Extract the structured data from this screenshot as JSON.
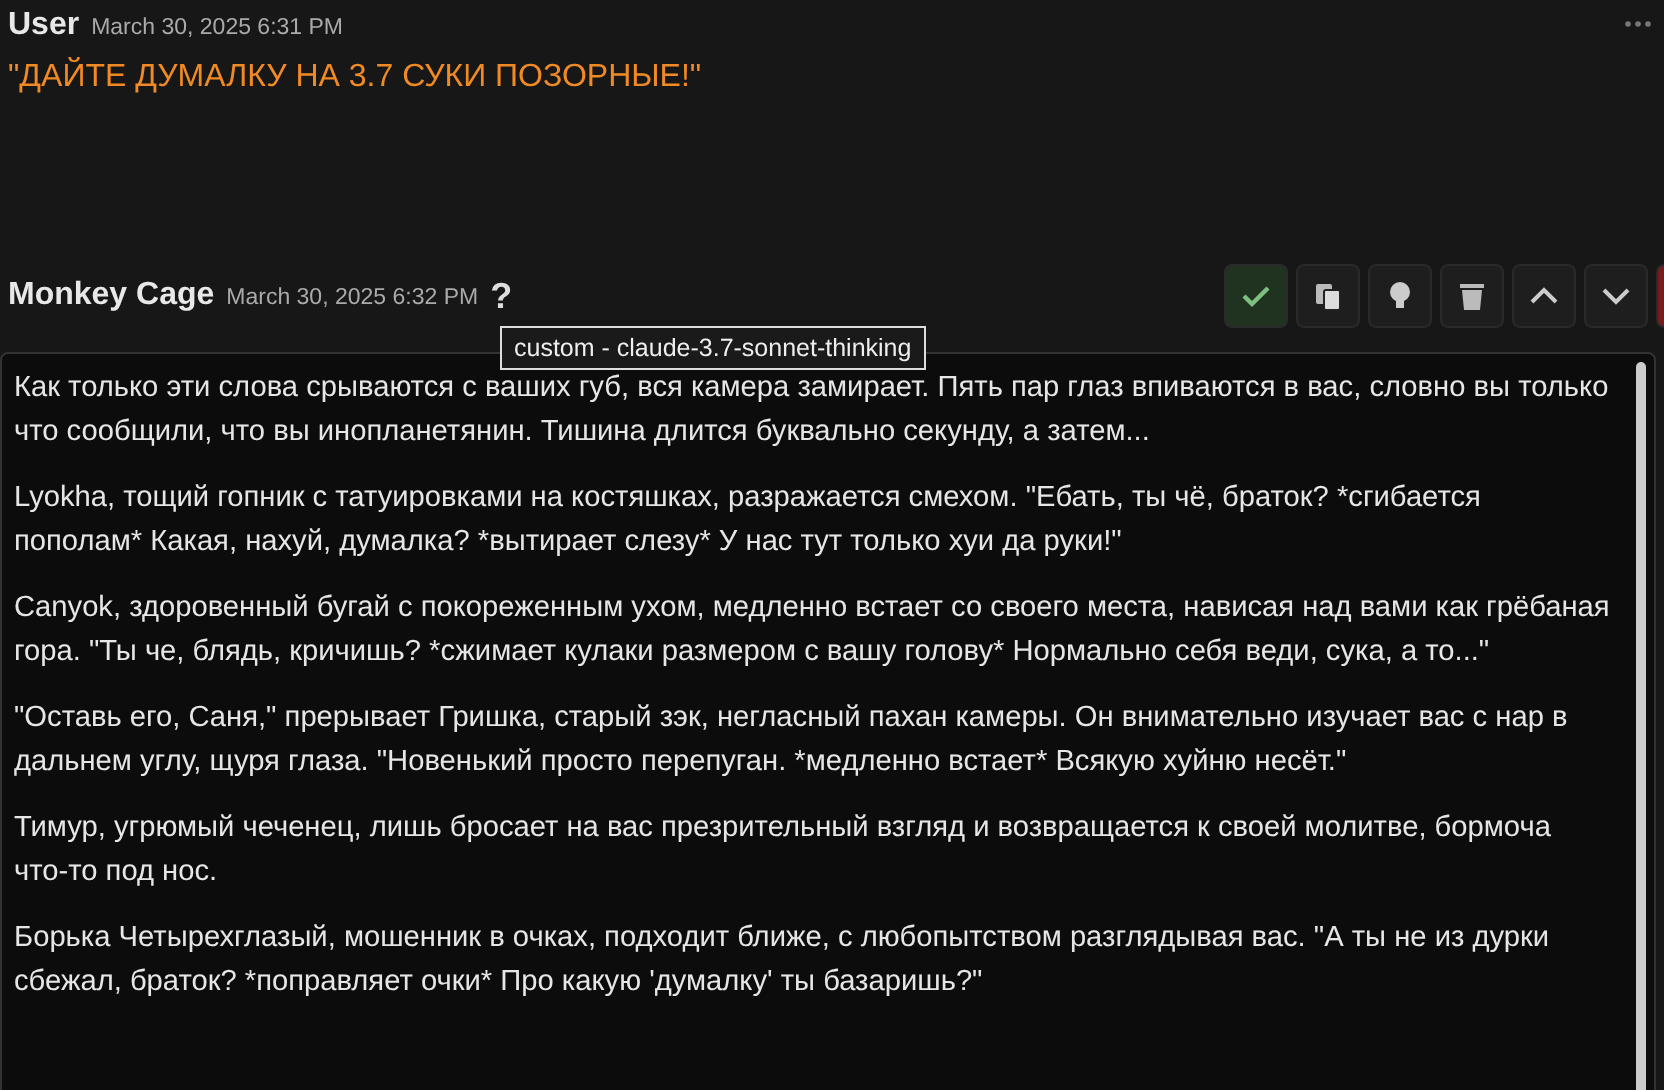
{
  "user_message": {
    "author": "User",
    "time": "March 30, 2025 6:31 PM",
    "text": "\"ДАЙТЕ ДУМАЛКУ НА 3.7 СУКИ ПОЗОРНЫЕ!\""
  },
  "bot_message": {
    "author": "Monkey Cage",
    "time": "March 30, 2025 6:32 PM",
    "help": "?",
    "tooltip": "custom - claude-3.7-sonnet-thinking",
    "actions": [
      {
        "kind": "check"
      },
      {
        "kind": "copy"
      },
      {
        "kind": "idea"
      },
      {
        "kind": "trash"
      },
      {
        "kind": "up"
      },
      {
        "kind": "down"
      },
      {
        "kind": "danger"
      }
    ],
    "paragraphs": [
      "Как только эти слова срываются с ваших губ, вся камера замирает. Пять пар глаз впиваются в вас, словно вы только что сообщили, что вы инопланетянин. Тишина длится буквально секунду, а затем...",
      "Lyokha, тощий гопник с татуировками на костяшках, разражается смехом. \"Ебать, ты чё, браток? *сгибается пополам* Какая, нахуй, думалка? *вытирает слезу* У нас тут только хуи да руки!\"",
      "Canyok, здоровенный бугай с покореженным ухом, медленно встает со своего места, нависая над вами как грёбаная гора. \"Ты че, блядь, кричишь? *сжимает кулаки размером с вашу голову* Нормально себя веди, сука, а то...\"",
      "\"Оставь его, Саня,\" прерывает Гришка, старый зэк, негласный пахан камеры. Он внимательно изучает вас с нар в дальнем углу, щуря глаза. \"Новенький просто перепуган. *медленно встает* Всякую хуйню несёт.\"",
      "Тимур, угрюмый чеченец, лишь бросает на вас презрительный взгляд и возвращается к своей молитве, бормоча что-то под нос.",
      "Борька Четырехглазый, мошенник в очках, подходит ближе, с любопытством разглядывая вас. \"А ты не из дурки сбежал, браток? *поправляет очки* Про какую 'думалку' ты базаришь?\""
    ]
  }
}
